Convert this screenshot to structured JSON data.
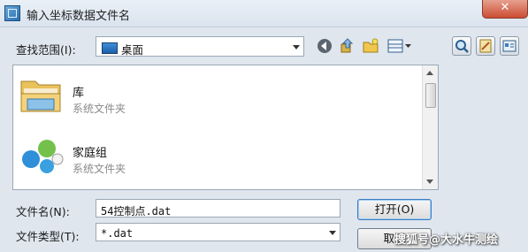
{
  "window": {
    "title": "输入坐标数据文件名",
    "close_glyph": "✕"
  },
  "lookin": {
    "label": "查找范围(I):",
    "value": "桌面",
    "icon": "desktop-icon"
  },
  "toolbar": {
    "icons": [
      "back-icon",
      "up-folder-icon",
      "new-folder-icon",
      "view-menu-icon"
    ],
    "right_icons": [
      "search-icon",
      "tools-icon",
      "properties-icon"
    ]
  },
  "list": {
    "items": [
      {
        "name": "库",
        "type": "系统文件夹",
        "icon": "library-folder-icon"
      },
      {
        "name": "家庭组",
        "type": "系统文件夹",
        "icon": "homegroup-icon"
      }
    ]
  },
  "filename": {
    "label": "文件名(N):",
    "value": "54控制点.dat"
  },
  "filetype": {
    "label": "文件类型(T):",
    "value": "*.dat"
  },
  "buttons": {
    "open": "打开(O)",
    "cancel": "取消"
  },
  "watermark": "搜狐号@大水牛测绘",
  "colors": {
    "titlebar": "#e3eaf3",
    "close": "#cc4d33",
    "window_bg": "#dfe6ee"
  }
}
